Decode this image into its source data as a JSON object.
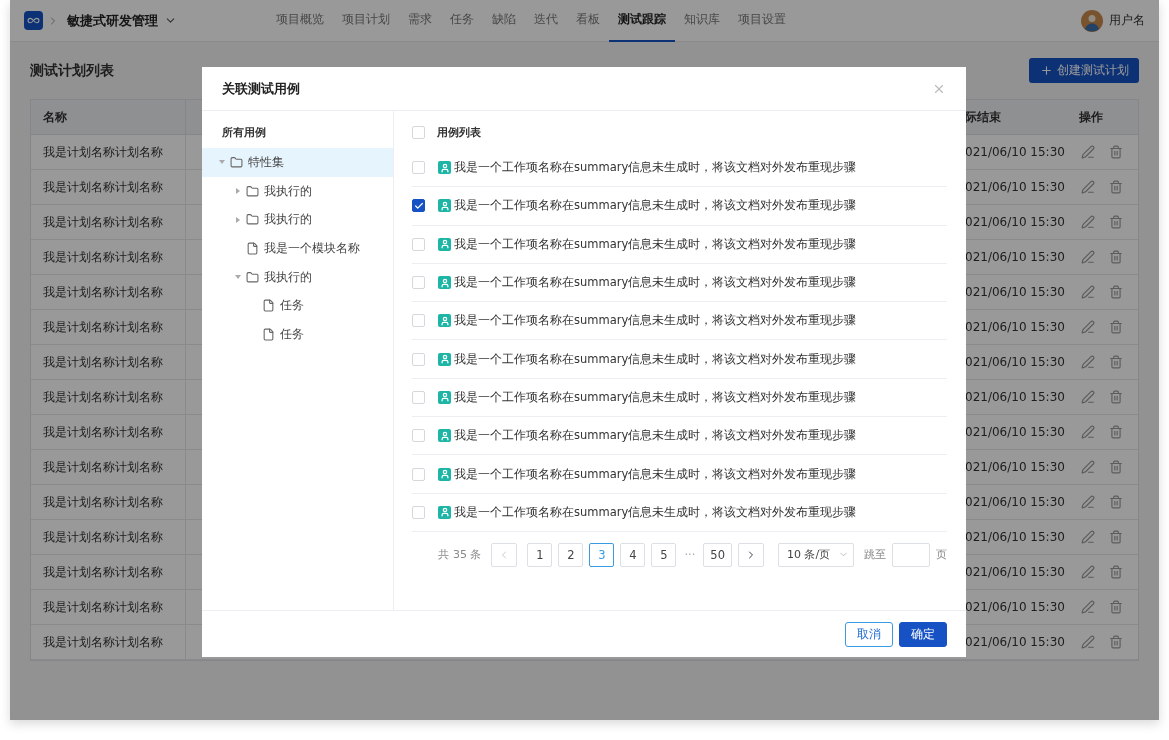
{
  "header": {
    "project": "敏捷式研发管理",
    "tabs": [
      {
        "label": "项目概览",
        "selected": false
      },
      {
        "label": "项目计划",
        "selected": false
      },
      {
        "label": "需求",
        "selected": false
      },
      {
        "label": "任务",
        "selected": false
      },
      {
        "label": "缺陷",
        "selected": false
      },
      {
        "label": "迭代",
        "selected": false
      },
      {
        "label": "看板",
        "selected": false
      },
      {
        "label": "测试跟踪",
        "selected": true
      },
      {
        "label": "知识库",
        "selected": false
      },
      {
        "label": "项目设置",
        "selected": false
      }
    ],
    "user": "用户名"
  },
  "page": {
    "title": "测试计划列表",
    "create_button": "创建测试计划"
  },
  "table": {
    "columns": [
      "名称",
      "际结束",
      "操作"
    ],
    "rows": [
      {
        "name": "我是计划名称计划名称",
        "end": "021/06/10 15:30"
      },
      {
        "name": "我是计划名称计划名称",
        "end": "021/06/10 15:30"
      },
      {
        "name": "我是计划名称计划名称",
        "end": "021/06/10 15:30"
      },
      {
        "name": "我是计划名称计划名称",
        "end": "021/06/10 15:30"
      },
      {
        "name": "我是计划名称计划名称",
        "end": "021/06/10 15:30"
      },
      {
        "name": "我是计划名称计划名称",
        "end": "021/06/10 15:30"
      },
      {
        "name": "我是计划名称计划名称",
        "end": "021/06/10 15:30"
      },
      {
        "name": "我是计划名称计划名称",
        "end": "021/06/10 15:30"
      },
      {
        "name": "我是计划名称计划名称",
        "end": "021/06/10 15:30"
      },
      {
        "name": "我是计划名称计划名称",
        "end": "021/06/10 15:30"
      },
      {
        "name": "我是计划名称计划名称",
        "end": "021/06/10 15:30"
      },
      {
        "name": "我是计划名称计划名称",
        "end": "021/06/10 15:30"
      },
      {
        "name": "我是计划名称计划名称",
        "end": "021/06/10 15:30"
      },
      {
        "name": "我是计划名称计划名称",
        "end": "021/06/10 15:30"
      },
      {
        "name": "我是计划名称计划名称",
        "end": "021/06/10 15:30"
      }
    ]
  },
  "dialog": {
    "title": "关联测试用例",
    "tree": {
      "title": "所有用例",
      "items": [
        {
          "label": "特性集",
          "kind": "folder",
          "expanded": true,
          "selected": true,
          "children": [
            {
              "label": "我执行的",
              "kind": "folder",
              "expanded": false,
              "selected": false
            },
            {
              "label": "我执行的",
              "kind": "folder",
              "expanded": false,
              "selected": false
            },
            {
              "label": "我是一个模块名称",
              "kind": "file",
              "selected": false
            },
            {
              "label": "我执行的",
              "kind": "folder",
              "expanded": true,
              "selected": false,
              "children": [
                {
                  "label": "任务",
                  "kind": "file",
                  "selected": false
                },
                {
                  "label": "任务",
                  "kind": "file",
                  "selected": false
                }
              ]
            }
          ]
        }
      ]
    },
    "list": {
      "title": "用例列表",
      "all_checked": false,
      "rows": [
        {
          "text": "我是一个工作项名称在summary信息未生成时，将该文档对外发布重现步骤",
          "checked": false
        },
        {
          "text": "我是一个工作项名称在summary信息未生成时，将该文档对外发布重现步骤",
          "checked": true
        },
        {
          "text": "我是一个工作项名称在summary信息未生成时，将该文档对外发布重现步骤",
          "checked": false
        },
        {
          "text": "我是一个工作项名称在summary信息未生成时，将该文档对外发布重现步骤",
          "checked": false
        },
        {
          "text": "我是一个工作项名称在summary信息未生成时，将该文档对外发布重现步骤",
          "checked": false
        },
        {
          "text": "我是一个工作项名称在summary信息未生成时，将该文档对外发布重现步骤",
          "checked": false
        },
        {
          "text": "我是一个工作项名称在summary信息未生成时，将该文档对外发布重现步骤",
          "checked": false
        },
        {
          "text": "我是一个工作项名称在summary信息未生成时，将该文档对外发布重现步骤",
          "checked": false
        },
        {
          "text": "我是一个工作项名称在summary信息未生成时，将该文档对外发布重现步骤",
          "checked": false
        },
        {
          "text": "我是一个工作项名称在summary信息未生成时，将该文档对外发布重现步骤",
          "checked": false
        }
      ]
    },
    "pagination": {
      "total": "共 35 条",
      "prev": {
        "disabled": true
      },
      "next": {
        "disabled": false
      },
      "pages": [
        {
          "kind": "page",
          "label": "1",
          "selected": false
        },
        {
          "kind": "page",
          "label": "2",
          "selected": false
        },
        {
          "kind": "page",
          "label": "3",
          "selected": true
        },
        {
          "kind": "page",
          "label": "4",
          "selected": false
        },
        {
          "kind": "page",
          "label": "5",
          "selected": false
        },
        {
          "kind": "ellipsis",
          "label": "···",
          "selected": false
        },
        {
          "kind": "page",
          "label": "50",
          "selected": false
        }
      ],
      "page_size": "10 条/页",
      "jump_label": "跳至",
      "jump_suffix": "页"
    },
    "buttons": {
      "cancel": "取消",
      "ok": "确定"
    }
  }
}
